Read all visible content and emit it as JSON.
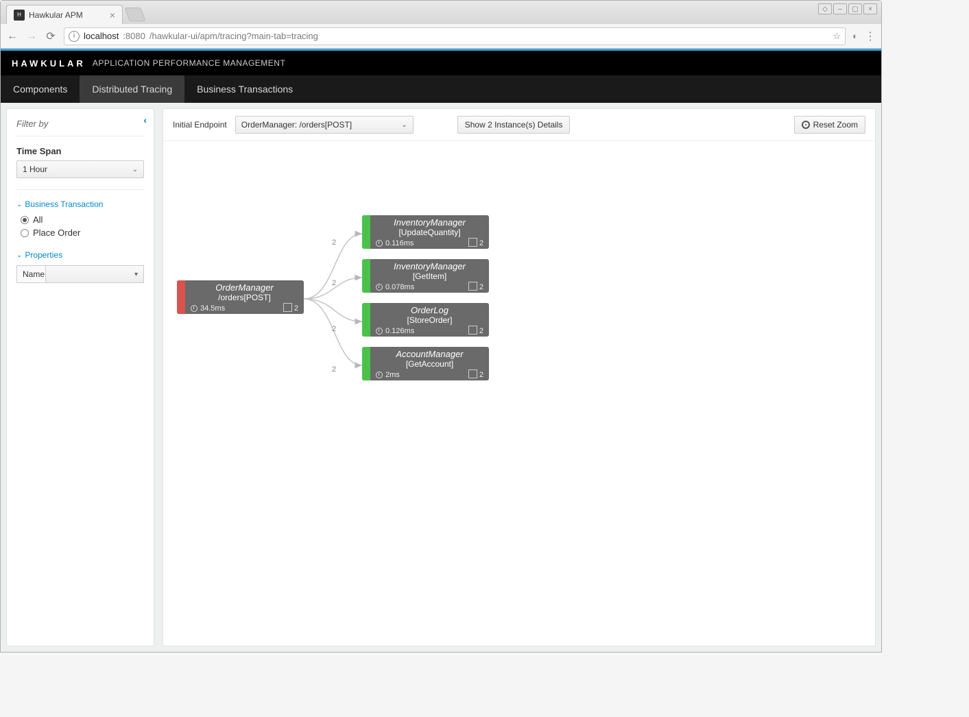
{
  "browser": {
    "tab_title": "Hawkular APM",
    "url_host": "localhost",
    "url_port": ":8080",
    "url_path": "/hawkular-ui/apm/tracing?main-tab=tracing"
  },
  "header": {
    "brand": "HAWKULAR",
    "subtitle": "APPLICATION PERFORMANCE MANAGEMENT"
  },
  "nav": {
    "items": [
      "Components",
      "Distributed Tracing",
      "Business Transactions"
    ],
    "active_index": 1
  },
  "sidebar": {
    "filter_by": "Filter by",
    "time_span_label": "Time Span",
    "time_span_value": "1 Hour",
    "bt_section": "Business Transaction",
    "bt_options": [
      {
        "label": "All",
        "checked": true
      },
      {
        "label": "Place Order",
        "checked": false
      }
    ],
    "props_section": "Properties",
    "props_name_label": "Name"
  },
  "toolbar": {
    "initial_endpoint_label": "Initial Endpoint",
    "initial_endpoint_value": "OrderManager: /orders[POST]",
    "instances_button": "Show 2 Instance(s) Details",
    "reset_zoom": "Reset Zoom"
  },
  "graph": {
    "root": {
      "title": "OrderManager",
      "subtitle": "/orders[POST]",
      "duration": "34.5ms",
      "count": "2",
      "status": "red"
    },
    "children": [
      {
        "title": "InventoryManager",
        "subtitle": "[UpdateQuantity]",
        "duration": "0.116ms",
        "count": "2",
        "edge_label": "2",
        "status": "green"
      },
      {
        "title": "InventoryManager",
        "subtitle": "[GetItem]",
        "duration": "0.078ms",
        "count": "2",
        "edge_label": "2",
        "status": "green"
      },
      {
        "title": "OrderLog",
        "subtitle": "[StoreOrder]",
        "duration": "0.126ms",
        "count": "2",
        "edge_label": "2",
        "status": "green"
      },
      {
        "title": "AccountManager",
        "subtitle": "[GetAccount]",
        "duration": "2ms",
        "count": "2",
        "edge_label": "2",
        "status": "green"
      }
    ]
  }
}
